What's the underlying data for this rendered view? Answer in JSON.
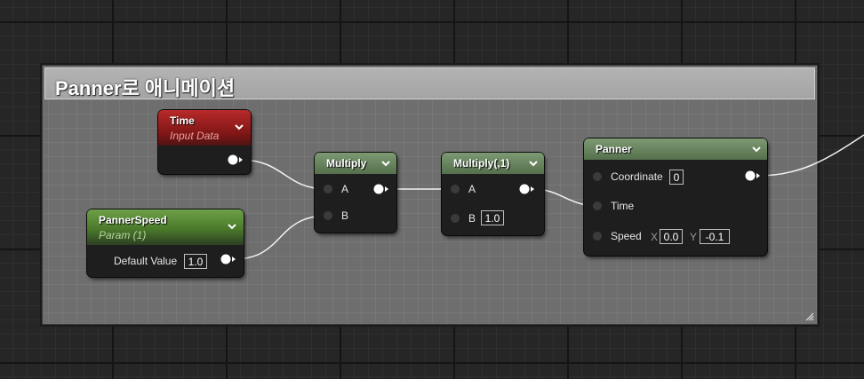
{
  "comment": {
    "title": "Panner로 애니메이션"
  },
  "nodes": {
    "time": {
      "title": "Time",
      "subtitle": "Input Data",
      "header_color": "#9b1f1f"
    },
    "panner_speed": {
      "title": "PannerSpeed",
      "subtitle": "Param (1)",
      "header_color": "#4b7a2a",
      "default_label": "Default Value",
      "default_value": "1.0"
    },
    "multiply1": {
      "title": "Multiply",
      "pin_a": "A",
      "pin_b": "B"
    },
    "multiply2": {
      "title": "Multiply(,1)",
      "pin_a": "A",
      "pin_b": "B",
      "b_value": "1.0"
    },
    "panner": {
      "title": "Panner",
      "coordinate_label": "Coordinate",
      "coordinate_value": "0",
      "time_label": "Time",
      "speed_label": "Speed",
      "speed_x_label": "X",
      "speed_x_value": "0.0",
      "speed_y_label": "Y",
      "speed_y_value": "-0.1"
    }
  },
  "icons": [
    "chevron-down-icon",
    "output-pin-icon",
    "input-pin-icon",
    "resize-grip-icon"
  ],
  "colors": {
    "math_header": "#5c7a52",
    "param_header": "#4b7a2a",
    "input_header": "#9b1f1f",
    "wire": "#ffffff"
  }
}
